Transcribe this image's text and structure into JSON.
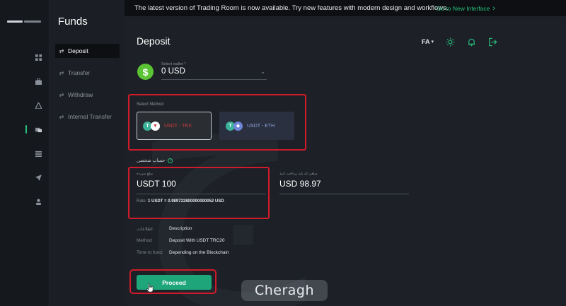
{
  "banner": {
    "message": "The latest version of Trading Room is now available. Try new features with modern design and workflows.",
    "link": "Go to New Interface"
  },
  "sidebar": {
    "title": "Funds",
    "items": [
      {
        "label": "Deposit",
        "active": true
      },
      {
        "label": "Transfer",
        "active": false
      },
      {
        "label": "Withdraw",
        "active": false
      },
      {
        "label": "Internal Transfer",
        "active": false
      }
    ]
  },
  "rail": {
    "icons": [
      "dashboard-icon",
      "briefcase-icon",
      "triangle-icon",
      "funds-icon",
      "list-icon",
      "rocket-icon",
      "user-icon"
    ],
    "active_index": 3
  },
  "header": {
    "title": "Deposit",
    "language": "FA",
    "icons": [
      "sun-icon",
      "bell-icon",
      "logout-icon"
    ]
  },
  "wallet": {
    "label": "Select wallet *",
    "value": "0 USD",
    "coin_symbol": "$"
  },
  "method": {
    "label": "Select Method",
    "options": [
      {
        "label": "USDT - TRX",
        "selected": true
      },
      {
        "label": "USDT - ETH",
        "selected": false
      }
    ]
  },
  "account": {
    "label": "حساب شخصی"
  },
  "amount": {
    "label": "مبلغ سپرده",
    "value": "USDT 100",
    "rate_prefix": "Rate: ",
    "rate_value": "1 USDT = 0.989722800000000052 USD"
  },
  "receive": {
    "label": "مبلغی که باید پرداخت کنید",
    "value": "USD 98.97"
  },
  "details": [
    {
      "key": "اطلاعات",
      "value": "Description"
    },
    {
      "key": "Method",
      "value": "Deposit With USDT TRC20"
    },
    {
      "key": "Time to fund:",
      "value": "Depending on the Blockchain"
    }
  ],
  "proceed_label": "Proceed",
  "watermark": {
    "logo_text": "Cheragh"
  },
  "colors": {
    "accent": "#1ea57a",
    "highlight_box": "#d11a2a",
    "banner_bg": "#0d0f12"
  }
}
